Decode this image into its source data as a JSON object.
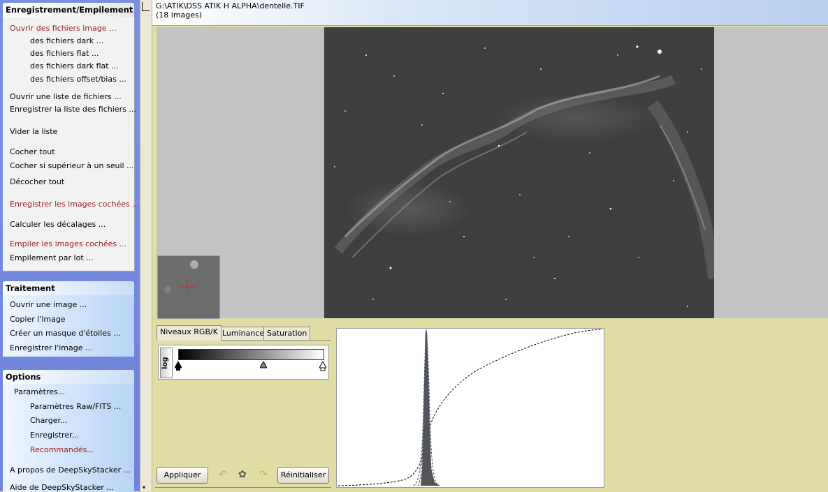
{
  "sidebar": {
    "registration": {
      "title": "Enregistrement/Empilement",
      "items": [
        {
          "label": "Ouvrir des fichiers image ..."
        },
        {
          "label": "des fichiers dark ..."
        },
        {
          "label": "des fichiers flat ..."
        },
        {
          "label": "des fichiers dark flat ..."
        },
        {
          "label": "des fichiers offset/bias ..."
        },
        {
          "label": "Ouvrir une liste de fichiers ..."
        },
        {
          "label": "Enregistrer la liste des fichiers ..."
        },
        {
          "label": "Vider la liste"
        },
        {
          "label": "Cocher tout"
        },
        {
          "label": "Cocher si supérieur à un seuil ..."
        },
        {
          "label": "Décocher tout"
        },
        {
          "label": "Enregistrer les images cochées ..."
        },
        {
          "label": "Calculer les décalages ..."
        },
        {
          "label": "Empiler les images cochées ..."
        },
        {
          "label": "Empilement par lot ..."
        }
      ]
    },
    "processing": {
      "title": "Traitement",
      "items": [
        {
          "label": "Ouvrir une image ..."
        },
        {
          "label": "Copier l'image"
        },
        {
          "label": "Créer un masque d'étoiles ..."
        },
        {
          "label": "Enregistrer l'image ..."
        }
      ]
    },
    "options": {
      "title": "Options",
      "items": [
        {
          "label": "Paramètres..."
        },
        {
          "label": "Paramètres Raw/FITS ..."
        },
        {
          "label": "Charger..."
        },
        {
          "label": "Enregistrer..."
        },
        {
          "label": "Recommandés..."
        },
        {
          "label": "A propos de DeepSkyStacker ..."
        },
        {
          "label": "Aide de DeepSkyStacker ..."
        }
      ]
    }
  },
  "header": {
    "path": "G:\\ATIK\\DSS ATIK H ALPHA\\dentelle.TIF",
    "count": "(18 images)"
  },
  "levels": {
    "tabs": [
      {
        "label": "Niveaux RGB/K"
      },
      {
        "label": "Luminance"
      },
      {
        "label": "Saturation"
      }
    ],
    "log_label": "log",
    "black_point": 0,
    "mid_point": 0.59,
    "white_point": 1,
    "apply_label": "Appliquer",
    "reset_label": "Réinitialiser",
    "undo_icon": "undo-icon",
    "settings_icon": "settings-icon",
    "redo_icon": "redo-icon"
  },
  "colors": {
    "panel_bg": "#e0dea4",
    "taskpane_bg": "#7b8fe0",
    "red_link": "#9b1c1c"
  }
}
